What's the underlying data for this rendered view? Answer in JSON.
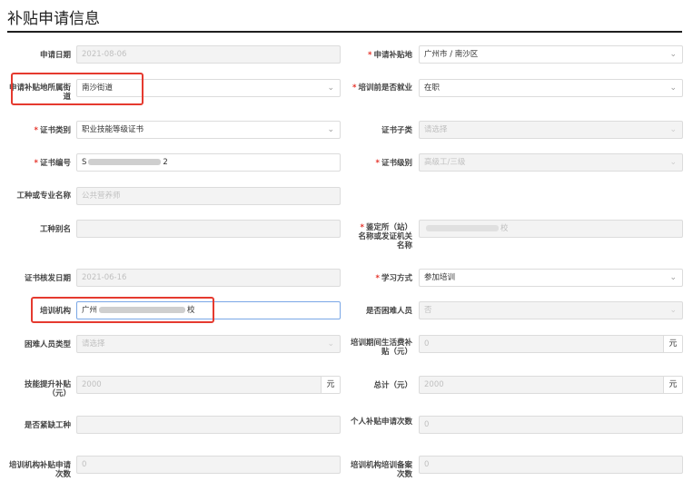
{
  "page_title": "补贴申请信息",
  "units": {
    "yuan": "元"
  },
  "fields": {
    "apply_date": {
      "label": "申请日期",
      "value": "2021-08-06"
    },
    "subsidy_location": {
      "label": "申请补贴地",
      "value": "广州市 / 南沙区"
    },
    "street": {
      "label": "申请补贴地所属街道",
      "value": "南沙街道"
    },
    "employed_before": {
      "label": "培训前是否就业",
      "value": "在职"
    },
    "cert_category": {
      "label": "证书类别",
      "value": "职业技能等级证书"
    },
    "cert_subtype": {
      "label": "证书子类",
      "placeholder": "请选择"
    },
    "cert_number": {
      "label": "证书编号",
      "value_prefix": "S",
      "value_suffix": "2"
    },
    "cert_level": {
      "label": "证书级别",
      "value": "高级工/三级"
    },
    "job_name": {
      "label": "工种或专业名称",
      "value": "公共营养师"
    },
    "job_alias": {
      "label": "工种别名",
      "value": ""
    },
    "appraisal_org": {
      "label": "鉴定所（站）名称或发证机关名称",
      "value_suffix": "校"
    },
    "cert_issue_date": {
      "label": "证书核发日期",
      "value": "2021-06-16"
    },
    "study_mode": {
      "label": "学习方式",
      "value": "参加培训"
    },
    "training_org": {
      "label": "培训机构",
      "value_prefix": "广州",
      "value_suffix": "校"
    },
    "is_hardship": {
      "label": "是否困难人员",
      "value": "否"
    },
    "hardship_type": {
      "label": "困难人员类型",
      "placeholder": "请选择"
    },
    "living_subsidy": {
      "label": "培训期间生活费补贴（元）",
      "value": "0"
    },
    "skill_subsidy": {
      "label": "技能提升补贴（元）",
      "value": "2000"
    },
    "total": {
      "label": "总计（元）",
      "value": "2000"
    },
    "is_shortage": {
      "label": "是否紧缺工种",
      "value": ""
    },
    "personal_apply_count": {
      "label": "个人补贴申请次数",
      "value": "0"
    },
    "org_apply_count": {
      "label": "培训机构补贴申请次数",
      "value": "0"
    },
    "org_record_count": {
      "label": "培训机构培训备案次数",
      "value": "0"
    }
  }
}
